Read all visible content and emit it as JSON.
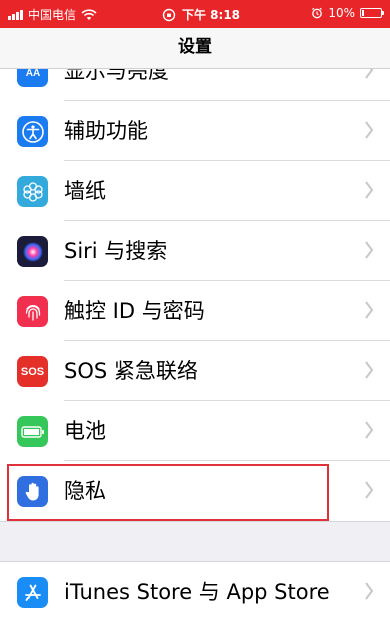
{
  "status_bar": {
    "carrier": "中国电信",
    "time": "下午 8:18",
    "battery": "10%",
    "battery_level": 0.1,
    "background": "#e8262a"
  },
  "nav": {
    "title": "设置"
  },
  "settings": {
    "items": [
      {
        "label": "显示与亮度",
        "icon": "display-brightness-icon",
        "color": "#1a7cf0"
      },
      {
        "label": "辅助功能",
        "icon": "accessibility-icon",
        "color": "#1a7cf0"
      },
      {
        "label": "墙纸",
        "icon": "wallpaper-icon",
        "color": "#34aadc"
      },
      {
        "label": "Siri 与搜索",
        "icon": "siri-icon",
        "color": "#1b1b3a"
      },
      {
        "label": "触控 ID 与密码",
        "icon": "touch-id-icon",
        "color": "#f0304e"
      },
      {
        "label": "SOS 紧急联络",
        "icon": "sos-icon",
        "color": "#e5302a",
        "icon_text": "SOS"
      },
      {
        "label": "电池",
        "icon": "battery-icon",
        "color": "#35c759"
      },
      {
        "label": "隐私",
        "icon": "privacy-hand-icon",
        "color": "#2f6fe0"
      }
    ],
    "store_item": {
      "label": "iTunes Store 与 App Store",
      "icon": "app-store-icon",
      "color": "#1a8cf5"
    }
  },
  "highlight": {
    "target": "隐私",
    "color": "#e0323a"
  }
}
